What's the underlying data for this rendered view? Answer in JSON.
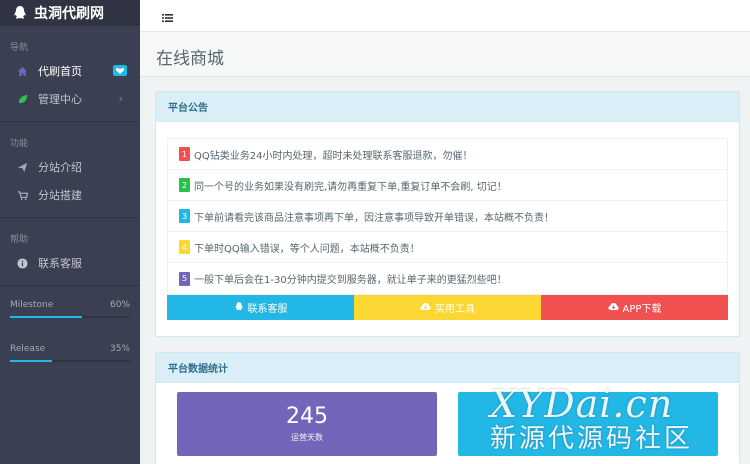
{
  "brand": {
    "title": "虫洞代刷网"
  },
  "sidebar": {
    "sections": {
      "nav": "导航",
      "features": "功能",
      "help": "帮助"
    },
    "items": [
      {
        "label": "代刷首页",
        "icon": "home-icon"
      },
      {
        "label": "管理中心",
        "icon": "leaf-icon"
      },
      {
        "label": "分站介绍",
        "icon": "send-icon"
      },
      {
        "label": "分站搭建",
        "icon": "cart-icon"
      },
      {
        "label": "联系客服",
        "icon": "info-icon"
      }
    ],
    "progress": [
      {
        "label": "Milestone",
        "value_text": "60%",
        "value": 60
      },
      {
        "label": "Release",
        "value_text": "35%",
        "value": 35
      }
    ]
  },
  "header": {
    "menu_icon": "menu-icon"
  },
  "page": {
    "title": "在线商城"
  },
  "notice": {
    "title": "平台公告",
    "items": [
      {
        "num": "1",
        "color": "#f05050",
        "text": "QQ钻类业务24小时内处理，超时未处理联系客服退款，勿催！"
      },
      {
        "num": "2",
        "color": "#27c24c",
        "text": "同一个号的业务如果没有刷完,请勿再重复下单,重复订单不会刷, 切记！"
      },
      {
        "num": "3",
        "color": "#23b7e5",
        "text": "下单前请看完该商品注意事项再下单，因注意事项导致开单错误，本站概不负责！"
      },
      {
        "num": "4",
        "color": "#fad733",
        "text": "下单时QQ输入错误，等个人问题，本站概不负责！"
      },
      {
        "num": "5",
        "color": "#7266ba",
        "text": "一般下单后会在1-30分钟内提交到服务器，就让单子来的更猛烈些吧！"
      }
    ],
    "buttons": [
      {
        "label": "联系客服",
        "color": "#23b7e5"
      },
      {
        "label": "实用工具",
        "color": "#fad733"
      },
      {
        "label": "APP下载",
        "color": "#f05050"
      }
    ]
  },
  "stats": {
    "title": "平台数据统计",
    "cards": [
      {
        "value": "245",
        "label": "运营天数",
        "color": "#7266ba"
      },
      {
        "value": "",
        "label": "",
        "color": "#23b7e5"
      }
    ]
  },
  "watermark": {
    "line1": "XYDai.cn",
    "line2": "新源代源码社区"
  }
}
